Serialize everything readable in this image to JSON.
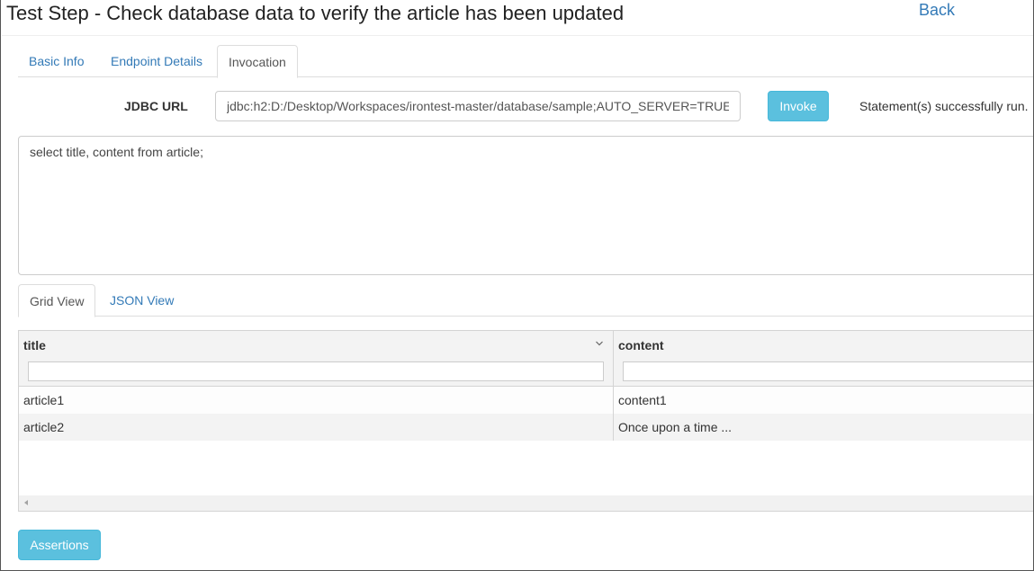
{
  "page": {
    "title": "Test Step - Check database data to verify the article has been updated",
    "back_label": "Back"
  },
  "tabs": [
    {
      "label": "Basic Info",
      "active": false
    },
    {
      "label": "Endpoint Details",
      "active": false
    },
    {
      "label": "Invocation",
      "active": true
    }
  ],
  "jdbc": {
    "label": "JDBC URL",
    "value": "jdbc:h2:D:/Desktop/Workspaces/irontest-master/database/sample;AUTO_SERVER=TRUE"
  },
  "invoke": {
    "label": "Invoke",
    "status": "Statement(s) successfully run."
  },
  "sql": {
    "statement": "select title, content from article;"
  },
  "result_tabs": [
    {
      "label": "Grid View",
      "active": true
    },
    {
      "label": "JSON View",
      "active": false
    }
  ],
  "grid": {
    "columns": [
      "title",
      "content"
    ],
    "rows": [
      [
        "article1",
        "content1"
      ],
      [
        "article2",
        "Once upon a time ..."
      ]
    ]
  },
  "assertions_label": "Assertions",
  "colors": {
    "link": "#337ab7",
    "info_button": "#5bc0de"
  }
}
